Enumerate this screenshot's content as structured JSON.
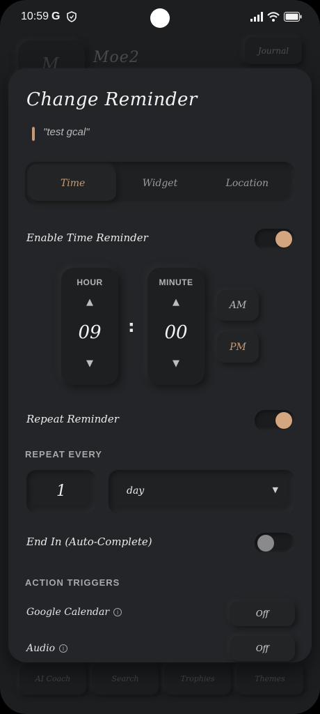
{
  "status": {
    "time": "10:59",
    "g_icon": "google-icon",
    "shield_icon": "shield-icon"
  },
  "background_app": {
    "avatar_letter": "M",
    "name": "Moe2",
    "journal_button": "Journal",
    "nav": [
      "AI Coach",
      "Search",
      "Trophies",
      "Themes"
    ]
  },
  "modal": {
    "title": "Change Reminder",
    "quote": "\"test gcal\"",
    "tabs": [
      {
        "label": "Time",
        "active": true
      },
      {
        "label": "Widget",
        "active": false
      },
      {
        "label": "Location",
        "active": false
      }
    ],
    "enable_time_reminder": {
      "label": "Enable Time Reminder",
      "on": true
    },
    "time": {
      "hour_label": "HOUR",
      "hour_value": "09",
      "minute_label": "MINUTE",
      "minute_value": "00",
      "up_glyph": "▲",
      "down_glyph": "▼",
      "separator": ":",
      "am": "AM",
      "pm": "PM",
      "selected_period": "PM"
    },
    "repeat_reminder": {
      "label": "Repeat Reminder",
      "on": true
    },
    "repeat_every": {
      "heading": "REPEAT EVERY",
      "count": "1",
      "unit": "day",
      "caret": "▼"
    },
    "end_in": {
      "label": "End In (Auto-Complete)",
      "on": false
    },
    "action_triggers": {
      "heading": "ACTION TRIGGERS",
      "items": [
        {
          "label": "Google Calendar",
          "info": "i",
          "value": "Off"
        },
        {
          "label": "Audio",
          "info": "i",
          "value": "Off"
        }
      ]
    }
  },
  "colors": {
    "accent": "#c89a74",
    "toggle_on": "#d4a67f",
    "toggle_off": "#8a8a8d",
    "surface": "#242528"
  }
}
